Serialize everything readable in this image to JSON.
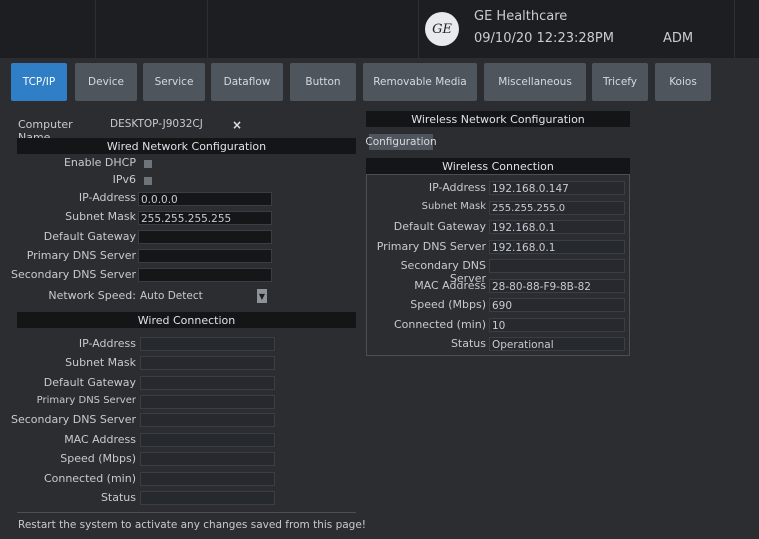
{
  "header": {
    "brand": "GE Healthcare",
    "datetime": "09/10/20 12:23:28PM",
    "user": "ADM",
    "logo_text": "GE"
  },
  "tabs": [
    {
      "label": "TCP/IP",
      "active": true
    },
    {
      "label": "Device"
    },
    {
      "label": "Service"
    },
    {
      "label": "Dataflow"
    },
    {
      "label": "Button"
    },
    {
      "label": "Removable Media"
    },
    {
      "label": "Miscellaneous"
    },
    {
      "label": "Tricefy"
    },
    {
      "label": "Koios"
    }
  ],
  "computer": {
    "label": "Computer Name",
    "value": "DESKTOP-J9032CJ",
    "clear": "×"
  },
  "wired_config": {
    "title": "Wired Network Configuration",
    "enable_dhcp": "Enable DHCP",
    "ipv6": "IPv6",
    "ip_label": "IP-Address",
    "ip_value": "0.0.0.0",
    "mask_label": "Subnet Mask",
    "mask_value": "255.255.255.255",
    "gateway_label": "Default Gateway",
    "pdns_label": "Primary DNS Server",
    "sdns_label": "Secondary DNS Server",
    "speed_label": "Network Speed:",
    "speed_value": "Auto Detect"
  },
  "wired_conn": {
    "title": "Wired Connection",
    "labels": [
      "IP-Address",
      "Subnet Mask",
      "Default Gateway",
      "Primary DNS Server",
      "Secondary DNS Server",
      "MAC Address",
      "Speed (Mbps)",
      "Connected (min)",
      "Status"
    ]
  },
  "wireless": {
    "title": "Wireless Network Configuration",
    "config_button": "Configuration",
    "conn_title": "Wireless Connection",
    "rows": [
      {
        "label": "IP-Address",
        "value": "192.168.0.147"
      },
      {
        "label": "Subnet Mask",
        "value": "255.255.255.0"
      },
      {
        "label": "Default Gateway",
        "value": "192.168.0.1"
      },
      {
        "label": "Primary DNS Server",
        "value": "192.168.0.1"
      },
      {
        "label": "Secondary DNS Server",
        "value": ""
      },
      {
        "label": "MAC Address",
        "value": "28-80-88-F9-8B-82"
      },
      {
        "label": "Speed (Mbps)",
        "value": "690"
      },
      {
        "label": "Connected (min)",
        "value": "10"
      },
      {
        "label": "Status",
        "value": "Operational"
      }
    ]
  },
  "footer": "Restart the system to activate any changes saved from this page!"
}
